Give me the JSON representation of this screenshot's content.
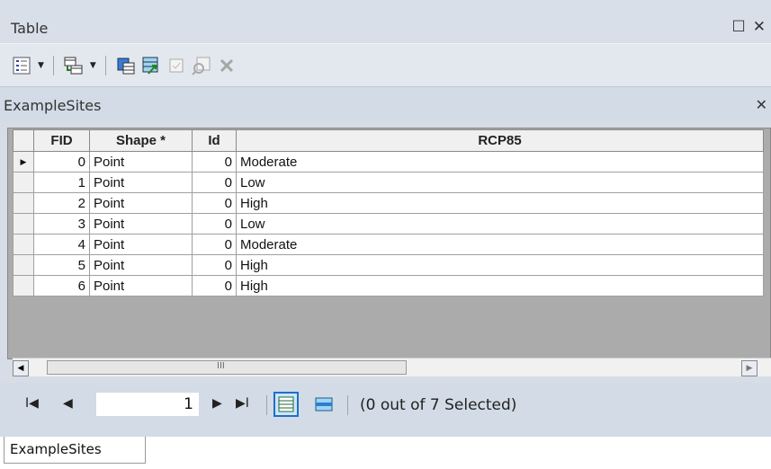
{
  "window": {
    "title": "Table",
    "restore_glyph": "☐",
    "close_glyph": "✕"
  },
  "toolbar": {
    "icons": [
      "table-options-icon",
      "related-tables-icon",
      "select-by-attributes-icon",
      "switch-selection-icon",
      "clear-selection-icon",
      "zoom-to-selected-icon",
      "delete-selected-icon"
    ]
  },
  "layer": {
    "name": "ExampleSites",
    "close_glyph": "✕"
  },
  "table": {
    "columns": [
      "FID",
      "Shape *",
      "Id",
      "RCP85"
    ],
    "rows": [
      [
        "0",
        "Point",
        "0",
        "Moderate"
      ],
      [
        "1",
        "Point",
        "0",
        "Low"
      ],
      [
        "2",
        "Point",
        "0",
        "High"
      ],
      [
        "3",
        "Point",
        "0",
        "Low"
      ],
      [
        "4",
        "Point",
        "0",
        "Moderate"
      ],
      [
        "5",
        "Point",
        "0",
        "High"
      ],
      [
        "6",
        "Point",
        "0",
        "High"
      ]
    ],
    "current_row_marker": "▶"
  },
  "scrollbar": {
    "grip": "III"
  },
  "navigation": {
    "first_glyph": "I◀",
    "prev_glyph": "◀",
    "record": "1",
    "next_glyph": "▶",
    "last_glyph": "▶I",
    "selection_status": "(0 out of 7 Selected)"
  },
  "bottom_tab": {
    "label": "ExampleSites"
  },
  "colors": {
    "title_bar": "#d8dfe8",
    "panel": "#d2dbe6",
    "accent": "#1e6fc8"
  }
}
